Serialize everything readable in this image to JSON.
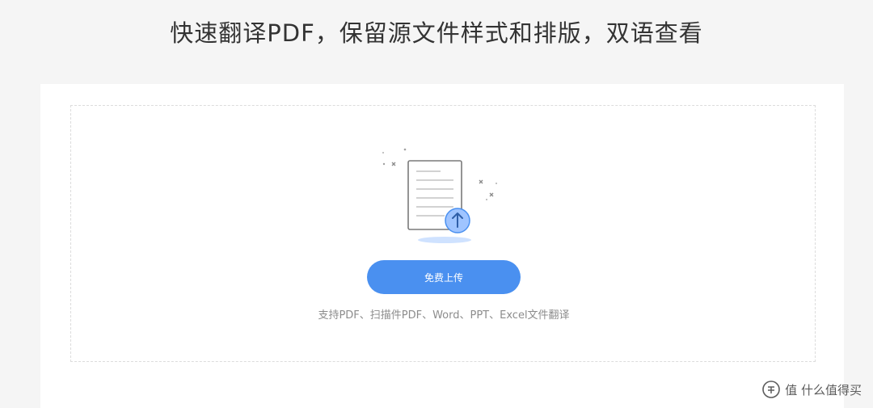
{
  "page": {
    "title": "快速翻译PDF，保留源文件样式和排版，双语查看"
  },
  "upload": {
    "icon": "document-upload-icon",
    "button_label": "免费上传",
    "support_text": "支持PDF、扫描件PDF、Word、PPT、Excel文件翻译"
  },
  "watermark": {
    "text": "值 什么值得买"
  },
  "colors": {
    "accent": "#4a90f0",
    "background": "#f5f5f5",
    "card": "#ffffff",
    "muted_text": "#8c8c8c"
  }
}
